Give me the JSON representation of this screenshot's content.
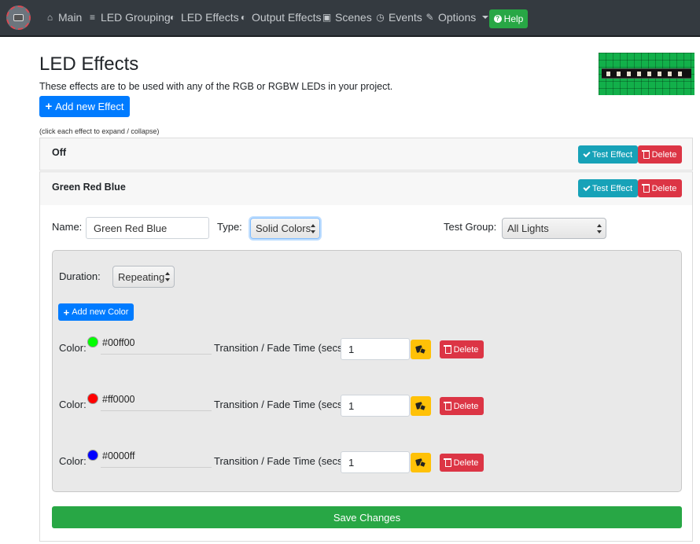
{
  "nav": {
    "items": [
      {
        "label": "Main",
        "icon": "home-icon"
      },
      {
        "label": "LED Grouping",
        "icon": "layers-icon"
      },
      {
        "label": "LED Effects",
        "icon": "adjust-icon"
      },
      {
        "label": "Output Effects",
        "icon": "adjust-icon"
      },
      {
        "label": "Scenes",
        "icon": "image-icon"
      },
      {
        "label": "Events",
        "icon": "clock-icon"
      },
      {
        "label": "Options",
        "icon": "wrench-icon"
      }
    ],
    "help_label": "Help"
  },
  "page": {
    "title": "LED Effects",
    "description": "These effects are to be used with any of the RGB or RGBW LEDs in your project.",
    "add_effect_label": "Add new Effect",
    "hint": "(click each effect to expand / collapse)"
  },
  "effects": [
    {
      "name": "Off",
      "test_label": "Test Effect",
      "delete_label": "Delete",
      "expanded": false
    },
    {
      "name": "Green Red Blue",
      "test_label": "Test Effect",
      "delete_label": "Delete",
      "expanded": true
    }
  ],
  "editor": {
    "name_label": "Name:",
    "name_value": "Green Red Blue",
    "type_label": "Type:",
    "type_value": "Solid Colors",
    "test_group_label": "Test Group:",
    "test_group_value": "All Lights",
    "duration_label": "Duration:",
    "duration_value": "Repeating",
    "add_color_label": "Add new Color",
    "color_label": "Color:",
    "fade_label": "Transition / Fade Time (secs):",
    "row_delete_label": "Delete",
    "colors": [
      {
        "hex": "#00ff00",
        "fade": "1",
        "swatch": "#00ff00"
      },
      {
        "hex": "#ff0000",
        "fade": "1",
        "swatch": "#ff0000"
      },
      {
        "hex": "#0000ff",
        "fade": "1",
        "swatch": "#0000ff"
      }
    ],
    "save_label": "Save Changes"
  },
  "colors": {
    "navbar": "#343a40",
    "primary": "#007bff",
    "info": "#17a2b8",
    "danger": "#dc3545",
    "success": "#28a745",
    "warning": "#ffc107"
  }
}
